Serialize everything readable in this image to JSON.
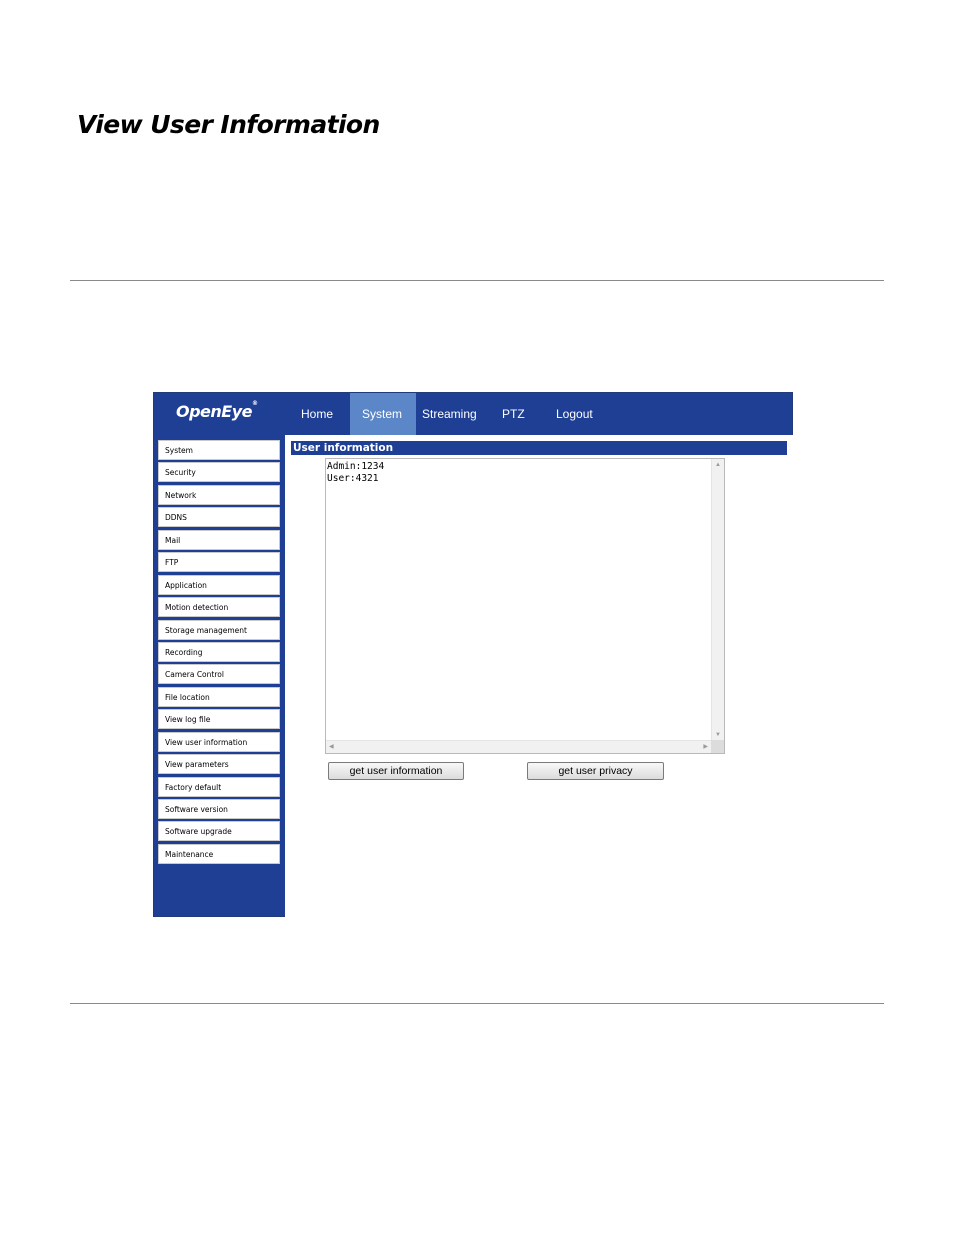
{
  "document": {
    "title": "View User Information"
  },
  "app": {
    "logo": "OpenEye",
    "logo_mark": "®",
    "nav": [
      {
        "label": "Home",
        "active": false
      },
      {
        "label": "System",
        "active": true
      },
      {
        "label": "Streaming",
        "active": false
      },
      {
        "label": "PTZ",
        "active": false
      },
      {
        "label": "Logout",
        "active": false
      }
    ],
    "sidebar": [
      {
        "label": "System"
      },
      {
        "label": "Security"
      },
      {
        "label": "Network"
      },
      {
        "label": "DDNS"
      },
      {
        "label": "Mail"
      },
      {
        "label": "FTP"
      },
      {
        "label": "Application"
      },
      {
        "label": "Motion detection"
      },
      {
        "label": "Storage management"
      },
      {
        "label": "Recording"
      },
      {
        "label": "Camera Control"
      },
      {
        "label": "File location"
      },
      {
        "label": "View log file"
      },
      {
        "label": "View user information"
      },
      {
        "label": "View parameters"
      },
      {
        "label": "Factory default"
      },
      {
        "label": "Software version"
      },
      {
        "label": "Software upgrade"
      },
      {
        "label": "Maintenance"
      }
    ],
    "panel": {
      "title": "User information",
      "lines": [
        "Admin:1234",
        "User:4321"
      ]
    },
    "buttons": {
      "get_user_information": "get user information",
      "get_user_privacy": "get user privacy"
    },
    "colors": {
      "brand_blue": "#1e3f94",
      "nav_active": "#5b87c9"
    }
  }
}
